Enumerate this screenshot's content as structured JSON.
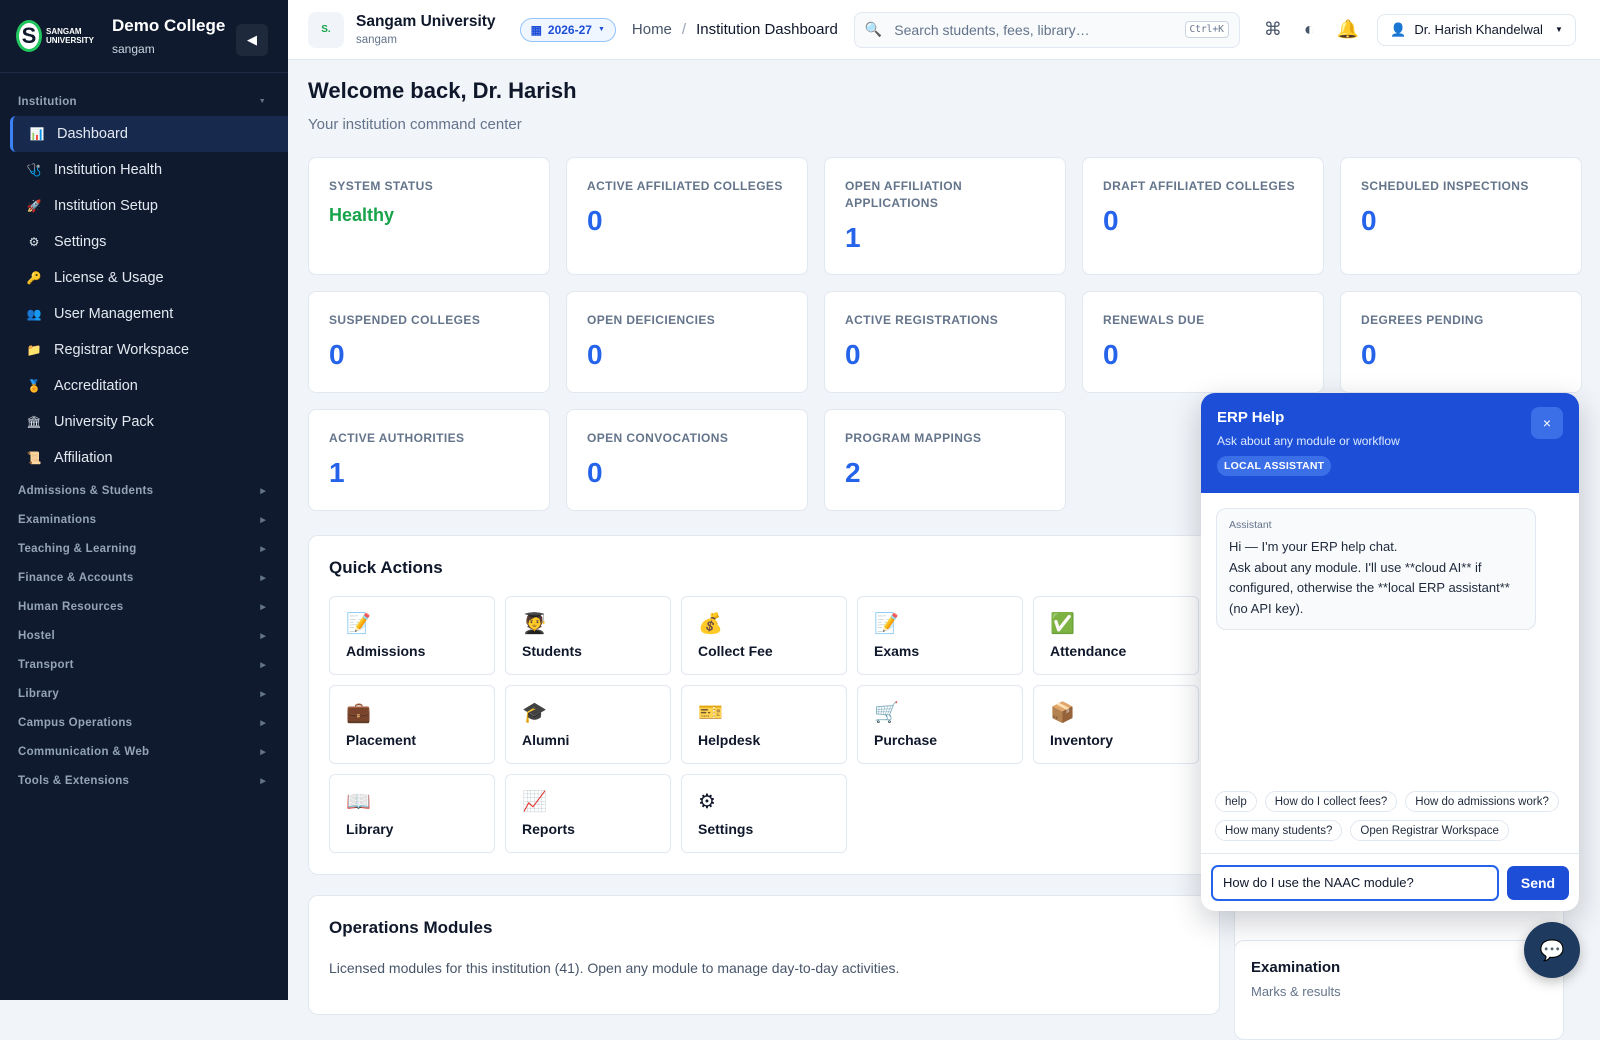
{
  "brand": {
    "logo_text": "SANGAM",
    "logo_sub": "UNIVERSITY",
    "logo_letter": "S",
    "college": "Demo College",
    "college_code": "sangam"
  },
  "sidebar": {
    "institution_section": "Institution",
    "items": [
      {
        "label": "Dashboard",
        "icon": "bar-chart-icon",
        "glyph": "📊"
      },
      {
        "label": "Institution Health",
        "icon": "stethoscope-icon",
        "glyph": "🩺"
      },
      {
        "label": "Institution Setup",
        "icon": "rocket-icon",
        "glyph": "🚀"
      },
      {
        "label": "Settings",
        "icon": "gear-icon",
        "glyph": "⚙"
      },
      {
        "label": "License & Usage",
        "icon": "key-icon",
        "glyph": "🔑"
      },
      {
        "label": "User Management",
        "icon": "users-icon",
        "glyph": "👥"
      },
      {
        "label": "Registrar Workspace",
        "icon": "folder-icon",
        "glyph": "📁"
      },
      {
        "label": "Accreditation",
        "icon": "medal-icon",
        "glyph": "🏅"
      },
      {
        "label": "University Pack",
        "icon": "building-icon",
        "glyph": "🏛"
      },
      {
        "label": "Affiliation",
        "icon": "scroll-icon",
        "glyph": "📜"
      }
    ],
    "sections": [
      "Admissions & Students",
      "Examinations",
      "Teaching & Learning",
      "Finance & Accounts",
      "Human Resources",
      "Hostel",
      "Transport",
      "Library",
      "Campus Operations",
      "Communication & Web",
      "Tools & Extensions"
    ]
  },
  "topbar": {
    "university": "Sangam University",
    "university_code": "sangam",
    "year": "2026-27",
    "crumb_home": "Home",
    "crumb_current": "Institution Dashboard",
    "search_placeholder": "Search students, fees, library…",
    "search_shortcut": "Ctrl+K",
    "user": "Dr. Harish Khandelwal"
  },
  "main": {
    "welcome": "Welcome back, Dr. Harish",
    "subtitle": "Your institution command center",
    "stats": [
      {
        "label": "SYSTEM STATUS",
        "value": "Healthy"
      },
      {
        "label": "ACTIVE AFFILIATED COLLEGES",
        "value": "0"
      },
      {
        "label": "OPEN AFFILIATION APPLICATIONS",
        "value": "1"
      },
      {
        "label": "DRAFT AFFILIATED COLLEGES",
        "value": "0"
      },
      {
        "label": "SCHEDULED INSPECTIONS",
        "value": "0"
      },
      {
        "label": "SUSPENDED COLLEGES",
        "value": "0"
      },
      {
        "label": "OPEN DEFICIENCIES",
        "value": "0"
      },
      {
        "label": "ACTIVE REGISTRATIONS",
        "value": "0"
      },
      {
        "label": "RENEWALS DUE",
        "value": "0"
      },
      {
        "label": "DEGREES PENDING",
        "value": "0"
      },
      {
        "label": "ACTIVE AUTHORITIES",
        "value": "1"
      },
      {
        "label": "OPEN CONVOCATIONS",
        "value": "0"
      },
      {
        "label": "PROGRAM MAPPINGS",
        "value": "2"
      }
    ],
    "quick_actions_title": "Quick Actions",
    "quick_actions": [
      {
        "label": "Admissions",
        "icon": "memo-icon",
        "glyph": "📝"
      },
      {
        "label": "Students",
        "icon": "student-icon",
        "glyph": "🧑‍🎓"
      },
      {
        "label": "Collect Fee",
        "icon": "money-bag-icon",
        "glyph": "💰"
      },
      {
        "label": "Exams",
        "icon": "memo-icon",
        "glyph": "📝"
      },
      {
        "label": "Attendance",
        "icon": "check-icon",
        "glyph": "✅"
      },
      {
        "label": "Placement",
        "icon": "briefcase-icon",
        "glyph": "💼"
      },
      {
        "label": "Alumni",
        "icon": "graduation-cap-icon",
        "glyph": "🎓"
      },
      {
        "label": "Helpdesk",
        "icon": "ticket-icon",
        "glyph": "🎫"
      },
      {
        "label": "Purchase",
        "icon": "cart-icon",
        "glyph": "🛒"
      },
      {
        "label": "Inventory",
        "icon": "package-icon",
        "glyph": "📦"
      },
      {
        "label": "Library",
        "icon": "book-icon",
        "glyph": "📖"
      },
      {
        "label": "Reports",
        "icon": "trend-chart-icon",
        "glyph": "📈"
      },
      {
        "label": "Settings",
        "icon": "gear-icon",
        "glyph": "⚙"
      }
    ],
    "ops_title": "Operations Modules",
    "ops_desc": "Licensed modules for this institution (41). Open any module to manage day-to-day activities.",
    "side_card_title": "Examination",
    "side_card_sub": "Marks & results"
  },
  "chat": {
    "title": "ERP Help",
    "subtitle": "Ask about any module or workflow",
    "badge": "LOCAL ASSISTANT",
    "close": "×",
    "sender": "Assistant",
    "message": "Hi — I'm your ERP help chat.\nAsk about any module. I'll use **cloud AI** if configured, otherwise the **local ERP assistant** (no API key).",
    "chips": [
      "help",
      "How do I collect fees?",
      "How do admissions work?",
      "How many students?",
      "Open Registrar Workspace"
    ],
    "input_value": "How do I use the NAAC module?",
    "send": "Send"
  },
  "colors": {
    "sidebar_bg": "#0f1a2e",
    "accent": "#1d4ed8",
    "stat_value": "#2563eb",
    "healthy": "#16a34a"
  }
}
